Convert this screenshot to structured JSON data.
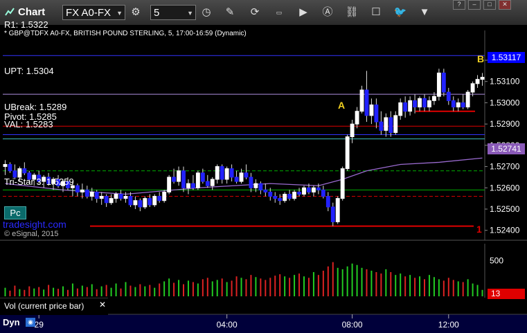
{
  "toolbar": {
    "app_title": "Chart",
    "symbol": "FX A0-FX",
    "interval": "5",
    "icons": [
      "settings-icon",
      "clock-icon",
      "pencil-icon",
      "refresh-icon",
      "quote-icon",
      "play-icon",
      "alert-icon",
      "link-icon",
      "comment-icon",
      "twitter-icon",
      "dropdown-icon"
    ],
    "window_buttons": [
      "?",
      "–",
      "□",
      "✕"
    ]
  },
  "chart_header": {
    "top_cut_label": "R1: 1.5322",
    "symbol_line": "* GBP@TDFX A0-FX, BRITISH POUND STERLING, 5, 17:00-16:59 (Dynamic)",
    "watermark": "tradesight.com",
    "copyright": "© eSignal, 2015",
    "pc_button": "Pc"
  },
  "chart_data": {
    "type": "candlestick",
    "symbol": "GBP@TDFX A0-FX",
    "interval": "5",
    "ylim": [
      1.5236,
      1.5334
    ],
    "yticks": [
      "1.53200",
      "1.53100",
      "1.53000",
      "1.52900",
      "1.52800",
      "1.52700",
      "1.52600",
      "1.52500",
      "1.52400"
    ],
    "x_ticks": [
      "29",
      "04:00",
      "08:00",
      "12:00"
    ],
    "price_badges": [
      {
        "value": "1.53117",
        "color": "#0000ff"
      },
      {
        "value": "1.52741",
        "color": "#8a5ab8"
      }
    ],
    "levels": [
      {
        "label": "R1: 1.5322",
        "value": 1.53222,
        "color": "#3333ff",
        "style": "solid"
      },
      {
        "label": "UPT: 1.5304",
        "value": 1.5304,
        "color": "#b090e0",
        "style": "solid"
      },
      {
        "label": "UBreak: 1.5289",
        "value": 1.5289,
        "color": "#e00000",
        "style": "solid"
      },
      {
        "label": "Pivot: 1.5285",
        "value": 1.5285,
        "color": "#3333ff",
        "style": "solid"
      },
      {
        "label": "VAL: 1.5283",
        "value": 1.5283,
        "color": "#40c0c0",
        "style": "solid"
      },
      {
        "label": "Tri-Star 3: 1.5259",
        "value": 1.5259,
        "color": "#00b000",
        "style": "solid"
      },
      {
        "label": "",
        "value": 1.5268,
        "color": "#00b000",
        "style": "dashed"
      },
      {
        "label": "",
        "value": 1.5256,
        "color": "#e00000",
        "style": "dashed"
      },
      {
        "label": "",
        "value": 1.5296,
        "color": "#e00000",
        "style": "solid"
      },
      {
        "label": "",
        "value": 1.5242,
        "color": "#e00000",
        "style": "solid"
      }
    ],
    "annotations": [
      {
        "text": "A",
        "color": "#f0d020"
      },
      {
        "text": "B",
        "color": "#f0d020"
      },
      {
        "text": "1",
        "color": "#e00000"
      }
    ],
    "ohlc": [
      [
        1.527,
        1.5273,
        1.5266,
        1.5271
      ],
      [
        1.5271,
        1.5272,
        1.5267,
        1.5268
      ],
      [
        1.5268,
        1.5271,
        1.5264,
        1.5265
      ],
      [
        1.5265,
        1.527,
        1.5263,
        1.5269
      ],
      [
        1.5269,
        1.5272,
        1.5266,
        1.5267
      ],
      [
        1.5267,
        1.5268,
        1.5262,
        1.5264
      ],
      [
        1.5264,
        1.5267,
        1.5261,
        1.5266
      ],
      [
        1.5266,
        1.5268,
        1.5262,
        1.5263
      ],
      [
        1.5263,
        1.5266,
        1.526,
        1.5265
      ],
      [
        1.5265,
        1.5267,
        1.5261,
        1.5262
      ],
      [
        1.5262,
        1.5265,
        1.5259,
        1.5264
      ],
      [
        1.5264,
        1.5266,
        1.526,
        1.5261
      ],
      [
        1.5261,
        1.5264,
        1.5258,
        1.5263
      ],
      [
        1.5263,
        1.5265,
        1.5259,
        1.526
      ],
      [
        1.526,
        1.5263,
        1.5256,
        1.5261
      ],
      [
        1.5261,
        1.5262,
        1.5256,
        1.5258
      ],
      [
        1.5258,
        1.5262,
        1.5255,
        1.5259
      ],
      [
        1.5259,
        1.5261,
        1.5255,
        1.5256
      ],
      [
        1.5256,
        1.526,
        1.5254,
        1.5258
      ],
      [
        1.5258,
        1.5259,
        1.5253,
        1.5255
      ],
      [
        1.5255,
        1.5258,
        1.5252,
        1.5256
      ],
      [
        1.5256,
        1.5257,
        1.5251,
        1.5253
      ],
      [
        1.5253,
        1.5257,
        1.5252,
        1.5255
      ],
      [
        1.5255,
        1.5258,
        1.5253,
        1.5257
      ],
      [
        1.5257,
        1.5259,
        1.5254,
        1.5255
      ],
      [
        1.5255,
        1.5258,
        1.5253,
        1.5256
      ],
      [
        1.5256,
        1.5258,
        1.5251,
        1.5252
      ],
      [
        1.5252,
        1.5256,
        1.525,
        1.5254
      ],
      [
        1.5254,
        1.5255,
        1.5249,
        1.5251
      ],
      [
        1.5251,
        1.5256,
        1.525,
        1.5255
      ],
      [
        1.5255,
        1.5257,
        1.5251,
        1.5252
      ],
      [
        1.5252,
        1.5257,
        1.5251,
        1.5256
      ],
      [
        1.5256,
        1.5258,
        1.5253,
        1.5254
      ],
      [
        1.5254,
        1.5259,
        1.5253,
        1.5258
      ],
      [
        1.5258,
        1.5266,
        1.5257,
        1.5265
      ],
      [
        1.5265,
        1.5269,
        1.5262,
        1.5263
      ],
      [
        1.5263,
        1.527,
        1.5261,
        1.5268
      ],
      [
        1.5268,
        1.527,
        1.5258,
        1.526
      ],
      [
        1.526,
        1.5264,
        1.5257,
        1.5262
      ],
      [
        1.5262,
        1.5266,
        1.5259,
        1.526
      ],
      [
        1.526,
        1.5268,
        1.5259,
        1.5267
      ],
      [
        1.5267,
        1.5269,
        1.5262,
        1.5263
      ],
      [
        1.5263,
        1.5266,
        1.526,
        1.5261
      ],
      [
        1.5261,
        1.5265,
        1.5259,
        1.5264
      ],
      [
        1.5264,
        1.5271,
        1.5262,
        1.527
      ],
      [
        1.527,
        1.5271,
        1.5262,
        1.5264
      ],
      [
        1.5264,
        1.527,
        1.5262,
        1.5269
      ],
      [
        1.5269,
        1.5271,
        1.5263,
        1.5265
      ],
      [
        1.5265,
        1.5268,
        1.5262,
        1.5263
      ],
      [
        1.5263,
        1.5269,
        1.5262,
        1.5267
      ],
      [
        1.5267,
        1.5271,
        1.5264,
        1.5265
      ],
      [
        1.5265,
        1.5267,
        1.5258,
        1.526
      ],
      [
        1.526,
        1.5264,
        1.5258,
        1.5262
      ],
      [
        1.5262,
        1.5263,
        1.5257,
        1.5259
      ],
      [
        1.5259,
        1.5262,
        1.5256,
        1.5258
      ],
      [
        1.5258,
        1.526,
        1.5254,
        1.5256
      ],
      [
        1.5256,
        1.5258,
        1.5253,
        1.5255
      ],
      [
        1.5255,
        1.5257,
        1.5252,
        1.5254
      ],
      [
        1.5254,
        1.5258,
        1.5253,
        1.5257
      ],
      [
        1.5257,
        1.5259,
        1.5254,
        1.5255
      ],
      [
        1.5255,
        1.5259,
        1.5254,
        1.5258
      ],
      [
        1.5258,
        1.526,
        1.5256,
        1.5257
      ],
      [
        1.5257,
        1.5261,
        1.5256,
        1.526
      ],
      [
        1.526,
        1.5262,
        1.5257,
        1.5258
      ],
      [
        1.5258,
        1.5261,
        1.5256,
        1.526
      ],
      [
        1.526,
        1.5262,
        1.5257,
        1.5259
      ],
      [
        1.5259,
        1.5261,
        1.5255,
        1.5256
      ],
      [
        1.5256,
        1.5258,
        1.5249,
        1.5251
      ],
      [
        1.5251,
        1.5253,
        1.5242,
        1.5244
      ],
      [
        1.5244,
        1.5256,
        1.5243,
        1.5255
      ],
      [
        1.5255,
        1.527,
        1.5254,
        1.5269
      ],
      [
        1.5269,
        1.5285,
        1.5268,
        1.5284
      ],
      [
        1.5284,
        1.5292,
        1.5281,
        1.529
      ],
      [
        1.529,
        1.5298,
        1.5288,
        1.5296
      ],
      [
        1.5296,
        1.5308,
        1.5295,
        1.5306
      ],
      [
        1.5306,
        1.5315,
        1.5291,
        1.5294
      ],
      [
        1.5294,
        1.5302,
        1.529,
        1.5299
      ],
      [
        1.5299,
        1.5302,
        1.5288,
        1.5291
      ],
      [
        1.5291,
        1.5296,
        1.5285,
        1.5287
      ],
      [
        1.5287,
        1.5295,
        1.5284,
        1.5293
      ],
      [
        1.5293,
        1.5296,
        1.5284,
        1.5286
      ],
      [
        1.5286,
        1.5296,
        1.5285,
        1.5294
      ],
      [
        1.5294,
        1.5302,
        1.5292,
        1.53
      ],
      [
        1.53,
        1.5303,
        1.5293,
        1.5296
      ],
      [
        1.5296,
        1.5303,
        1.5294,
        1.5301
      ],
      [
        1.5301,
        1.5304,
        1.5295,
        1.5298
      ],
      [
        1.5298,
        1.5303,
        1.5296,
        1.5302
      ],
      [
        1.5302,
        1.5304,
        1.5296,
        1.5298
      ],
      [
        1.5298,
        1.5303,
        1.5296,
        1.5301
      ],
      [
        1.5301,
        1.5305,
        1.5299,
        1.5303
      ],
      [
        1.5303,
        1.5316,
        1.5301,
        1.5314
      ],
      [
        1.5314,
        1.5316,
        1.5303,
        1.5305
      ],
      [
        1.5305,
        1.5307,
        1.5299,
        1.5301
      ],
      [
        1.5301,
        1.5303,
        1.5296,
        1.5298
      ],
      [
        1.5298,
        1.5302,
        1.5296,
        1.53
      ],
      [
        1.53,
        1.5304,
        1.5297,
        1.5298
      ],
      [
        1.5298,
        1.5306,
        1.5297,
        1.5305
      ],
      [
        1.5305,
        1.531,
        1.5303,
        1.5309
      ],
      [
        1.5309,
        1.5313,
        1.5307,
        1.5311
      ],
      [
        1.5311,
        1.5314,
        1.5308,
        1.5312
      ]
    ],
    "moving_average": [
      [
        0,
        1.5262
      ],
      [
        12,
        1.5259
      ],
      [
        25,
        1.5257
      ],
      [
        40,
        1.526
      ],
      [
        55,
        1.5262
      ],
      [
        65,
        1.5261
      ],
      [
        70,
        1.5264
      ],
      [
        75,
        1.5268
      ],
      [
        82,
        1.5271
      ],
      [
        90,
        1.5272
      ],
      [
        99,
        1.5274
      ]
    ],
    "volume_panel": {
      "title": "Vol (current price bar)",
      "yticks": [
        "500"
      ],
      "current_value": "13",
      "ylim": [
        0,
        700
      ],
      "values": [
        120,
        80,
        150,
        100,
        90,
        140,
        110,
        130,
        95,
        160,
        120,
        105,
        140,
        90,
        180,
        110,
        150,
        130,
        170,
        100,
        140,
        160,
        120,
        180,
        110,
        200,
        150,
        130,
        170,
        140,
        160,
        120,
        180,
        210,
        250,
        190,
        230,
        170,
        220,
        200,
        180,
        240,
        260,
        210,
        230,
        250,
        200,
        220,
        280,
        260,
        240,
        300,
        270,
        250,
        230,
        260,
        290,
        310,
        280,
        260,
        300,
        320,
        280,
        260,
        340,
        300,
        360,
        420,
        480,
        400,
        380,
        420,
        460,
        440,
        400,
        380,
        360,
        340,
        320,
        380,
        340,
        300,
        320,
        280,
        300,
        260,
        280,
        240,
        300,
        270,
        240,
        220,
        260,
        230,
        210,
        200,
        240,
        180,
        160,
        90
      ]
    }
  },
  "footer": {
    "dyn_label": "Dyn"
  }
}
